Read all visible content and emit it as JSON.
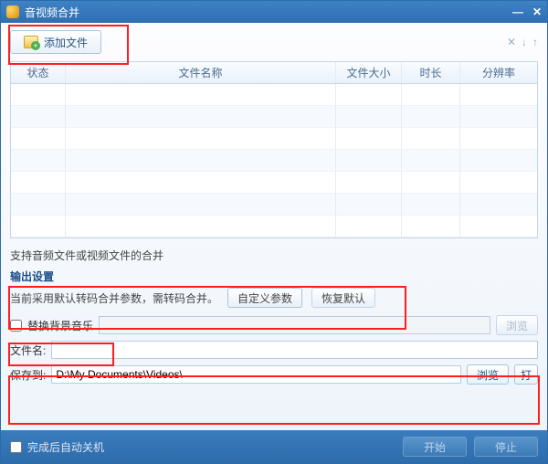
{
  "titlebar": {
    "title": "音视频合并"
  },
  "topbar": {
    "add_file": "添加文件"
  },
  "columns": {
    "status": "状态",
    "name": "文件名称",
    "size": "文件大小",
    "dur": "时长",
    "res": "分辨率"
  },
  "hint": "支持音频文件或视频文件的合并",
  "output": {
    "title": "输出设置",
    "note": "当前采用默认转码合并参数，需转码合并。",
    "custom": "自定义参数",
    "restore": "恢复默认"
  },
  "bgm": {
    "label": "替换背景音乐",
    "value": "",
    "browse": "浏览"
  },
  "file": {
    "name_label": "文件名:",
    "name_value": "",
    "save_label": "保存到:",
    "save_value": "D:\\My Documents\\Videos\\",
    "browse": "浏览",
    "open": "打"
  },
  "footer": {
    "shutdown": "完成后自动关机",
    "start": "开始",
    "stop": "停止"
  }
}
